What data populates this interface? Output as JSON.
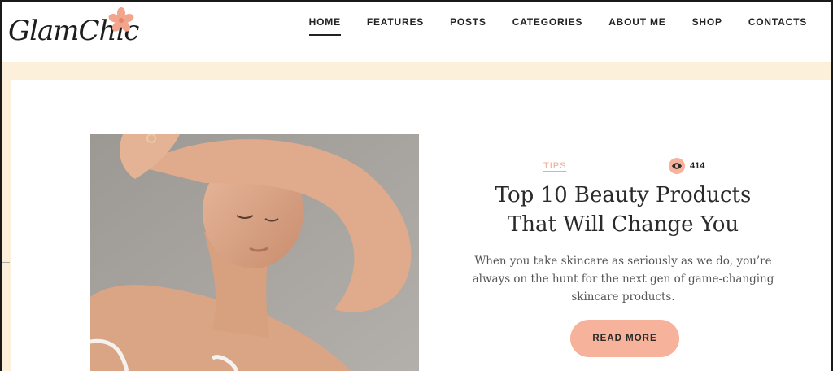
{
  "brand": {
    "logo_text": "GlamChic"
  },
  "nav": {
    "items": [
      {
        "label": "HOME",
        "active": true
      },
      {
        "label": "FEATURES"
      },
      {
        "label": "POSTS"
      },
      {
        "label": "CATEGORIES"
      },
      {
        "label": "ABOUT ME"
      },
      {
        "label": "SHOP"
      },
      {
        "label": "CONTACTS"
      }
    ]
  },
  "post": {
    "category": "TIPS",
    "views": "414",
    "title_line1": "Top 10 Beauty Products",
    "title_line2": "That Will Change You",
    "excerpt": "When you take skincare as seriously as we do, you’re always on the hunt for the next gen of game-changing skincare products.",
    "read_more": "READ MORE"
  },
  "colors": {
    "accent": "#f6b29b",
    "band": "#fdf0da",
    "tag": "#f0a88e"
  },
  "icons": {
    "views": "eye-icon",
    "logo": "flower-icon"
  }
}
